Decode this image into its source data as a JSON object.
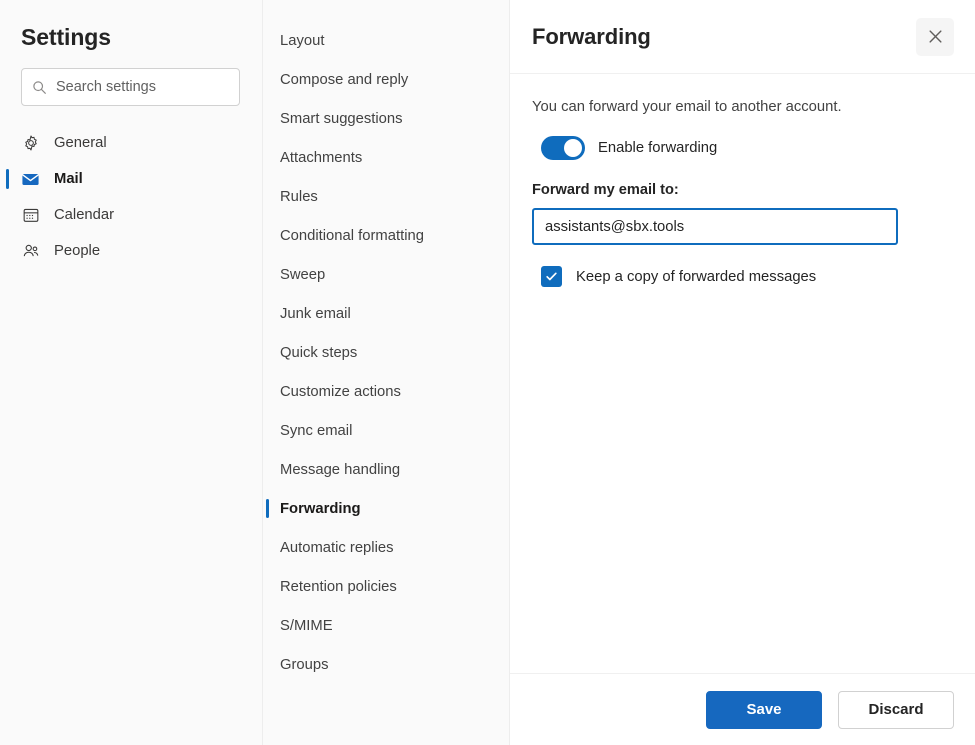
{
  "sidebar": {
    "title": "Settings",
    "search": {
      "placeholder": "Search settings",
      "value": "",
      "icon": "search-icon"
    },
    "items": [
      {
        "label": "General",
        "icon": "gear-icon",
        "selected": false
      },
      {
        "label": "Mail",
        "icon": "envelope-icon",
        "selected": true
      },
      {
        "label": "Calendar",
        "icon": "calendar-icon",
        "selected": false
      },
      {
        "label": "People",
        "icon": "people-icon",
        "selected": false
      }
    ]
  },
  "subnav": {
    "items": [
      {
        "label": "Layout",
        "selected": false
      },
      {
        "label": "Compose and reply",
        "selected": false
      },
      {
        "label": "Smart suggestions",
        "selected": false
      },
      {
        "label": "Attachments",
        "selected": false
      },
      {
        "label": "Rules",
        "selected": false
      },
      {
        "label": "Conditional formatting",
        "selected": false
      },
      {
        "label": "Sweep",
        "selected": false
      },
      {
        "label": "Junk email",
        "selected": false
      },
      {
        "label": "Quick steps",
        "selected": false
      },
      {
        "label": "Customize actions",
        "selected": false
      },
      {
        "label": "Sync email",
        "selected": false
      },
      {
        "label": "Message handling",
        "selected": false
      },
      {
        "label": "Forwarding",
        "selected": true
      },
      {
        "label": "Automatic replies",
        "selected": false
      },
      {
        "label": "Retention policies",
        "selected": false
      },
      {
        "label": "S/MIME",
        "selected": false
      },
      {
        "label": "Groups",
        "selected": false
      }
    ]
  },
  "panel": {
    "title": "Forwarding",
    "close_icon": "close-icon",
    "intro": "You can forward your email to another account.",
    "toggle": {
      "label": "Enable forwarding",
      "on": true
    },
    "email_field": {
      "label": "Forward my email to:",
      "value": "assistants@sbx.tools",
      "placeholder": "",
      "focused": true
    },
    "keep_copy": {
      "label": "Keep a copy of forwarded messages",
      "checked": true
    },
    "footer": {
      "save_label": "Save",
      "discard_label": "Discard"
    }
  },
  "colors": {
    "accent": "#0f6cbd",
    "primary_button": "#1668bf",
    "sidebar_bg": "#fafafa",
    "panel_bg": "#ffffff",
    "text": "#242424",
    "muted_text": "#424242",
    "divider": "#f0f0f0"
  }
}
